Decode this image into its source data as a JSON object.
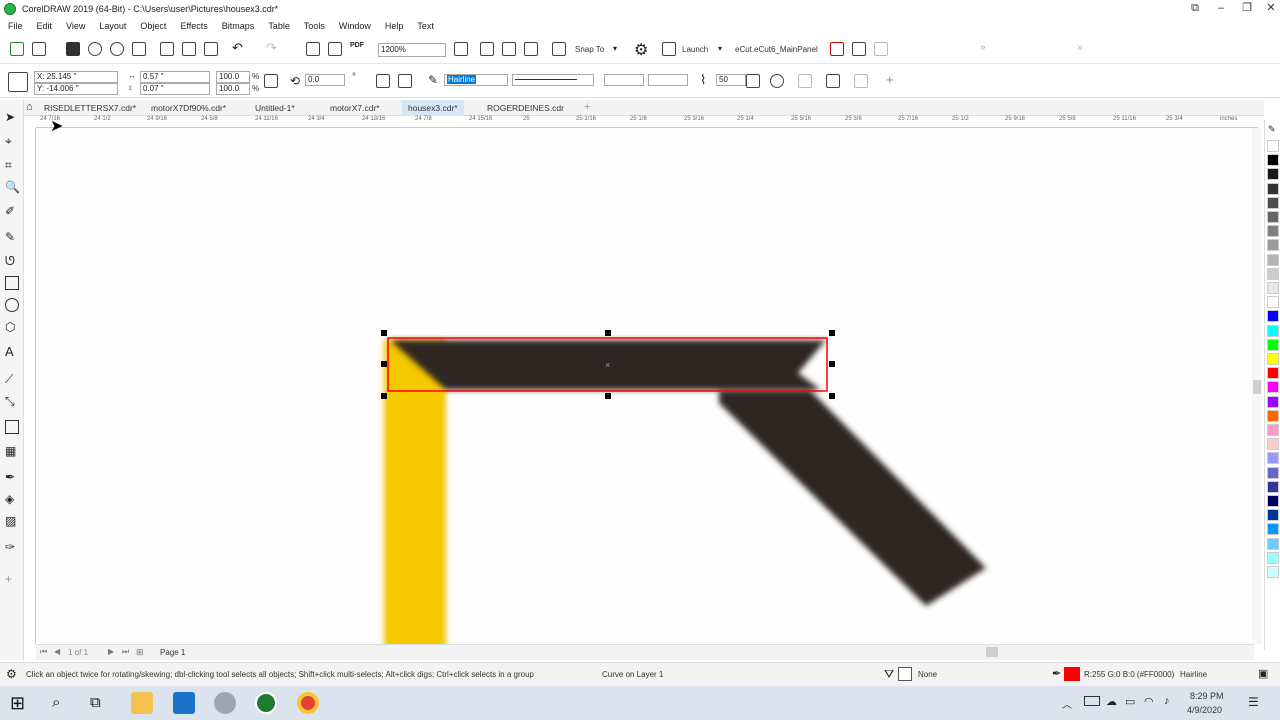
{
  "window": {
    "title": "CorelDRAW 2019 (64-Bit) - C:\\Users\\user\\Pictures\\housex3.cdr*"
  },
  "menu": [
    "File",
    "Edit",
    "View",
    "Layout",
    "Object",
    "Effects",
    "Bitmaps",
    "Table",
    "Tools",
    "Window",
    "Help",
    "Text"
  ],
  "standard_toolbar": {
    "zoom": "1200%",
    "pdf_label": "PDF",
    "snap_to": "Snap To",
    "launch": "Launch",
    "macro": "eCut.eCut6_MainPanel"
  },
  "property_bar": {
    "x": "X: 25.145 \"",
    "y": "Y: -14.006 \"",
    "width": "0.57 \"",
    "height": "0.07 \"",
    "scale_x": "100.0",
    "scale_y": "100.0",
    "percent": "%",
    "rotation": "0.0",
    "outline_width": "Hairline",
    "smoothing": "50",
    "degree": "°"
  },
  "doc_tabs": [
    {
      "label": "RISEDLETTERSX7.cdr*",
      "active": false
    },
    {
      "label": "motorX7Df90%.cdr*",
      "active": false
    },
    {
      "label": "Untitled-1*",
      "active": false
    },
    {
      "label": "motorX7.cdr*",
      "active": false
    },
    {
      "label": "housex3.cdr*",
      "active": true
    },
    {
      "label": "ROGERDEINES.cdr",
      "active": false
    }
  ],
  "ruler_labels": [
    "24 7/16",
    "24 1/2",
    "24 9/16",
    "24 5/8",
    "24 11/16",
    "24 3/4",
    "24 13/16",
    "24 7/8",
    "24 15/16",
    "25",
    "25 1/16",
    "25 1/8",
    "25 3/16",
    "25 1/4",
    "25 5/16",
    "25 3/8",
    "25 7/16",
    "25 1/2",
    "25 9/16",
    "25 5/8",
    "25 11/16",
    "25 3/4",
    "inches"
  ],
  "page_nav": {
    "of_label": "1 of 1",
    "page_tab": "Page 1"
  },
  "status": {
    "hint": "Click an object twice for rotating/skewing; dbl-clicking tool selects all objects; Shift+click multi-selects; Alt+click digs; Ctrl+click selects in a group",
    "object_info": "Curve on Layer 1",
    "fill_label": "None",
    "outline_color": "R:255 G:0 B:0 (#FF0000)",
    "outline_width": "Hairline"
  },
  "taskbar": {
    "time": "8:29 PM",
    "date": "4/9/2020"
  },
  "colors": {
    "accent": "#d7e7f7",
    "selection": "#ff0000",
    "shape_dark": "#2f2623",
    "shape_yellow": "#f5c800"
  },
  "palette": [
    "#ffffff",
    "#000000",
    "#1a1a1a",
    "#333333",
    "#4d4d4d",
    "#666666",
    "#808080",
    "#999999",
    "#b3b3b3",
    "#cccccc",
    "#e6e6e6",
    "#ffffff",
    "#0000ff",
    "#00ffff",
    "#00ff00",
    "#ffff00",
    "#ff0000",
    "#ff00ff",
    "#9900ff",
    "#ff6600",
    "#ff99cc",
    "#ffcccc",
    "#9999ff",
    "#6666cc",
    "#333399",
    "#000066",
    "#003399",
    "#0099ff",
    "#66ccff",
    "#99ffff",
    "#ccffff"
  ]
}
